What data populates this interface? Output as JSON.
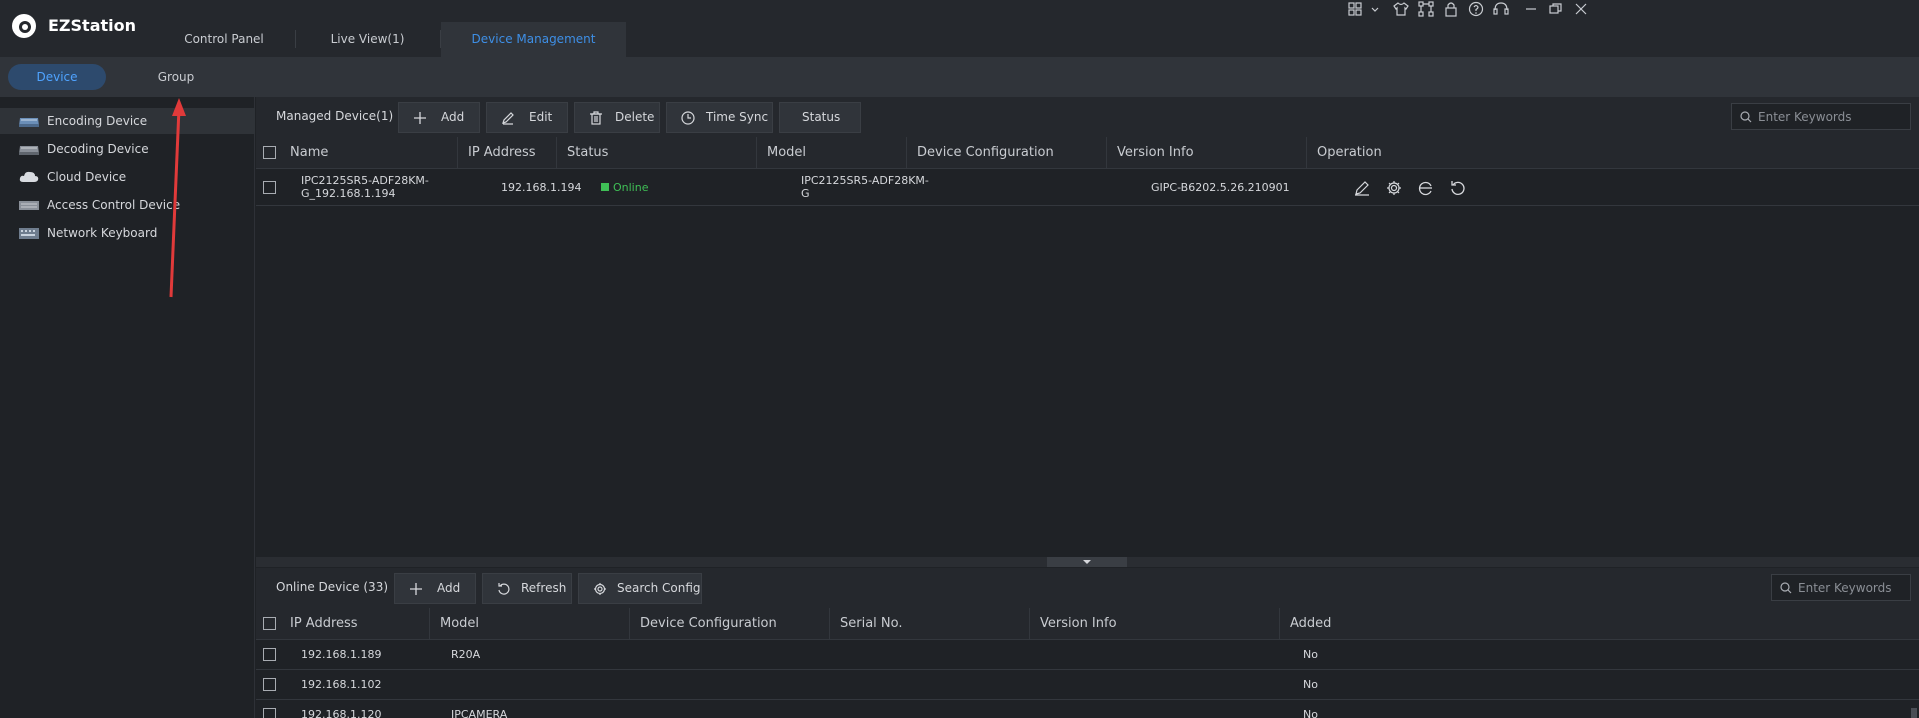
{
  "app": {
    "name": "EZStation"
  },
  "main_tabs": [
    {
      "label": "Control Panel"
    },
    {
      "label": "Live View(1)"
    },
    {
      "label": "Device Management"
    }
  ],
  "sub_tabs": [
    {
      "label": "Device"
    },
    {
      "label": "Group"
    }
  ],
  "sidebar": {
    "items": [
      {
        "label": "Encoding Device",
        "icon": "encoding-device-icon"
      },
      {
        "label": "Decoding Device",
        "icon": "decoding-device-icon"
      },
      {
        "label": "Cloud Device",
        "icon": "cloud-device-icon"
      },
      {
        "label": "Access Control Device",
        "icon": "access-control-icon"
      },
      {
        "label": "Network Keyboard",
        "icon": "keyboard-icon"
      }
    ]
  },
  "managed": {
    "title": "Managed Device(1)",
    "buttons": {
      "add": "Add",
      "edit": "Edit",
      "delete": "Delete",
      "time_sync": "Time Sync",
      "status": "Status"
    },
    "search_placeholder": "Enter Keywords",
    "columns": [
      "Name",
      "IP Address",
      "Status",
      "Model",
      "Device Configuration",
      "Version Info",
      "Operation"
    ],
    "rows": [
      {
        "name_line1": "IPC2125SR5-ADF28KM-",
        "name_line2": "G_192.168.1.194",
        "ip": "192.168.1.194",
        "status": "Online",
        "model_line1": "IPC2125SR5-ADF28KM-",
        "model_line2": "G",
        "config": "",
        "version": "GIPC-B6202.5.26.210901"
      }
    ]
  },
  "online": {
    "title": "Online Device (33)",
    "buttons": {
      "add": "Add",
      "refresh": "Refresh",
      "search_config": "Search Config"
    },
    "search_placeholder": "Enter Keywords",
    "columns": [
      "IP Address",
      "Model",
      "Device Configuration",
      "Serial No.",
      "Version Info",
      "Added"
    ],
    "rows": [
      {
        "ip": "192.168.1.189",
        "model": "R20A",
        "added": "No"
      },
      {
        "ip": "192.168.1.102",
        "model": "",
        "added": "No"
      },
      {
        "ip": "192.168.1.120",
        "model": "IPCAMERA",
        "added": "No"
      }
    ]
  },
  "colors": {
    "accent": "#3e8fe6",
    "online": "#3fbf56",
    "annotation_arrow": "#e03a3a"
  }
}
